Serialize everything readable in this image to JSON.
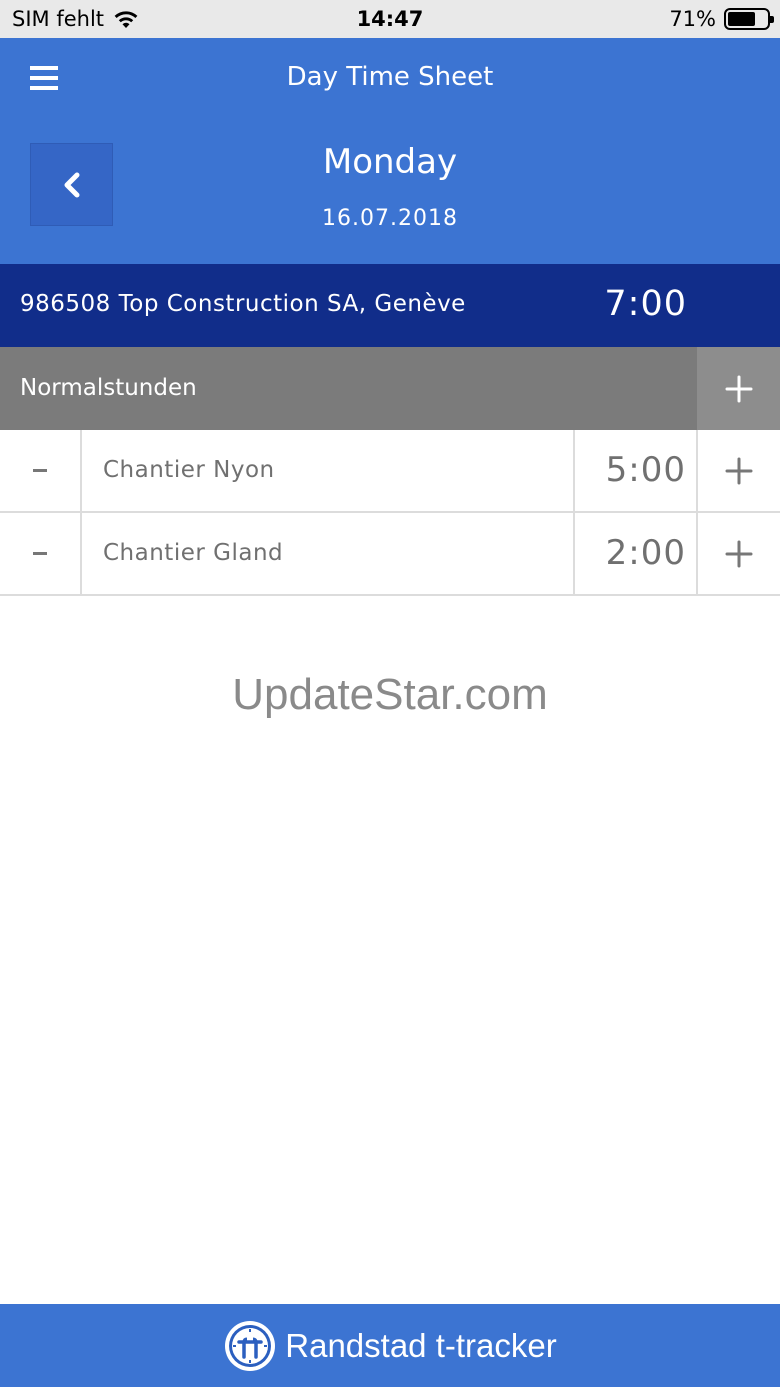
{
  "status_bar": {
    "carrier": "SIM fehlt",
    "time": "14:47",
    "battery": "71%",
    "battery_level": 0.71
  },
  "header": {
    "title": "Day Time Sheet",
    "day_name": "Monday",
    "date": "16.07.2018",
    "menu_icon": "hamburger-icon",
    "back_icon": "chevron-left-icon"
  },
  "project": {
    "name": "986508 Top Construction SA, Genève",
    "total": "7:00"
  },
  "category": {
    "label": "Normalstunden",
    "add_icon": "plus-icon"
  },
  "entries": [
    {
      "name": "Chantier Nyon",
      "hours": "5:00"
    },
    {
      "name": "Chantier Gland",
      "hours": "2:00"
    }
  ],
  "watermark": "UpdateStar.com",
  "footer": {
    "brand": "Randstad t-tracker",
    "logo_icon": "randstad-logo-icon"
  },
  "colors": {
    "header_blue": "#3c74d2",
    "project_navy": "#112d8a",
    "category_gray": "#7b7b7b"
  }
}
